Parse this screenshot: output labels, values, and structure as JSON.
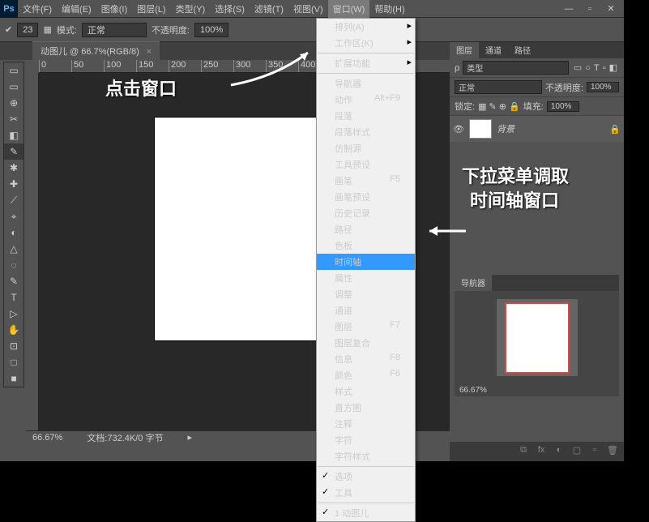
{
  "menus": [
    "文件(F)",
    "编辑(E)",
    "图像(I)",
    "图层(L)",
    "类型(Y)",
    "选择(S)",
    "滤镜(T)",
    "视图(V)",
    "窗口(W)",
    "帮助(H)"
  ],
  "active_menu_idx": 8,
  "options": {
    "mode_lbl": "模式:",
    "mode_val": "正常",
    "opacity_lbl": "不透明度:",
    "opacity_val": "100%",
    "size": "23"
  },
  "tab": {
    "title": "动图儿 @ 66.7%(RGB/8)"
  },
  "ruler_h": [
    "0",
    "50",
    "100",
    "150",
    "200",
    "250",
    "300",
    "350",
    "400"
  ],
  "tools": [
    "▭",
    "▭",
    "⊕",
    "✂",
    "◧",
    "✎",
    "✱",
    "✚",
    "⟋",
    "⌖",
    "◐",
    "△",
    "◌",
    "✎",
    "T",
    "▷",
    "✋",
    "⊡",
    "□",
    "■"
  ],
  "layers_panel": {
    "tabs": [
      "图层",
      "通道",
      "路径"
    ],
    "kind": "类型",
    "filter_icons": [
      "▭",
      "○",
      "T",
      "▫",
      "◧"
    ],
    "blend": "正常",
    "opacity_lbl": "不透明度:",
    "opacity": "100%",
    "lock_lbl": "锁定:",
    "fill_lbl": "填充:",
    "fill": "100%",
    "layer_name": "背景"
  },
  "nav": {
    "tab": "导航器",
    "pct": "66.67%"
  },
  "status": {
    "zoom": "66.67%",
    "doc": "文档:732.4K/0 字节"
  },
  "dropdown": [
    {
      "t": "排列(A)",
      "sub": true
    },
    {
      "t": "工作区(K)",
      "sub": true
    },
    {
      "sep": true
    },
    {
      "t": "扩展功能",
      "sub": true,
      "dis": true
    },
    {
      "sep": true
    },
    {
      "t": "导航器"
    },
    {
      "t": "动作",
      "k": "Alt+F9"
    },
    {
      "t": "段落"
    },
    {
      "t": "段落样式"
    },
    {
      "t": "仿制源"
    },
    {
      "t": "工具预设"
    },
    {
      "t": "画笔",
      "k": "F5"
    },
    {
      "t": "画笔预设"
    },
    {
      "t": "历史记录"
    },
    {
      "t": "路径"
    },
    {
      "t": "色板"
    },
    {
      "t": "时间轴",
      "hl": true
    },
    {
      "t": "属性"
    },
    {
      "t": "调整"
    },
    {
      "t": "通道"
    },
    {
      "t": "图层",
      "k": "F7"
    },
    {
      "t": "图层复合"
    },
    {
      "t": "信息",
      "k": "F8"
    },
    {
      "t": "颜色",
      "k": "F6"
    },
    {
      "t": "样式"
    },
    {
      "t": "直方图"
    },
    {
      "t": "注释"
    },
    {
      "t": "字符"
    },
    {
      "t": "字符样式"
    },
    {
      "sep": true
    },
    {
      "t": "选项",
      "chk": true
    },
    {
      "t": "工具",
      "chk": true
    },
    {
      "sep": true
    },
    {
      "t": "1 动图儿",
      "chk": true
    }
  ],
  "annot": {
    "a1": "点击窗口",
    "a2": "下拉菜单调取",
    "a3": "时间轴窗口"
  }
}
